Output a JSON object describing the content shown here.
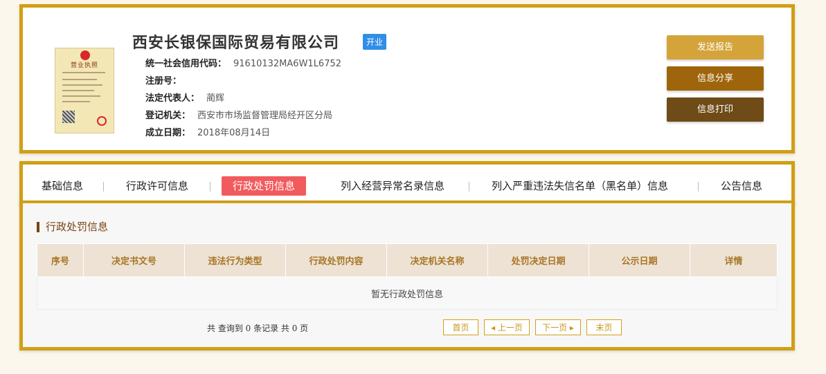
{
  "company": {
    "name": "西安长银保国际贸易有限公司",
    "status": "开业",
    "license_title": "营业执照",
    "fields": [
      {
        "label": "统一社会信用代码：",
        "value": "91610132MA6W1L6752"
      },
      {
        "label": "注册号：",
        "value": ""
      },
      {
        "label": "法定代表人：",
        "value": "蔺辉"
      },
      {
        "label": "登记机关：",
        "value": "西安市市场监督管理局经开区分局"
      },
      {
        "label": "成立日期：",
        "value": "2018年08月14日"
      }
    ]
  },
  "actions": {
    "send": "发送报告",
    "share": "信息分享",
    "print": "信息打印"
  },
  "tabs": [
    "基础信息",
    "行政许可信息",
    "行政处罚信息",
    "列入经营异常名录信息",
    "列入严重违法失信名单（黑名单）信息",
    "公告信息"
  ],
  "section": {
    "title": "行政处罚信息",
    "columns": [
      "序号",
      "决定书文号",
      "违法行为类型",
      "行政处罚内容",
      "决定机关名称",
      "处罚决定日期",
      "公示日期",
      "详情"
    ],
    "empty_text": "暂无行政处罚信息"
  },
  "pagination": {
    "summary": "共 查询到 0 条记录 共 0 页",
    "first": "首页",
    "prev": "上一页",
    "next": "下一页",
    "last": "末页"
  },
  "colors": {
    "border": "#d19f15",
    "active_tab": "#f15b5d",
    "badge": "#2f8ee8"
  }
}
